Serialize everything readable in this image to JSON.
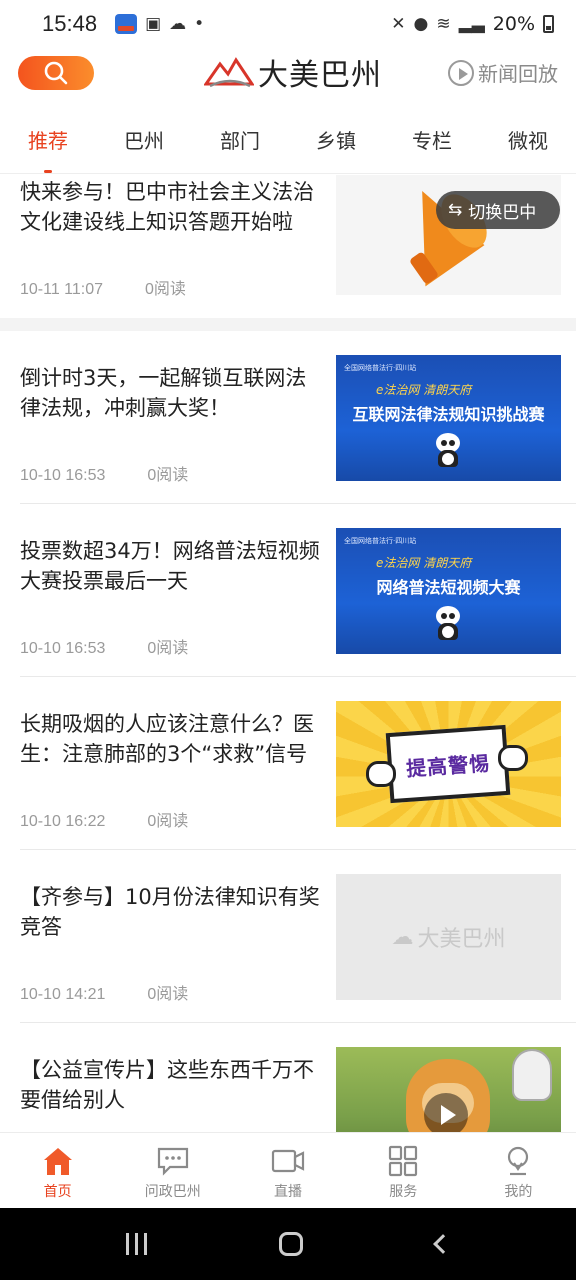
{
  "status_bar": {
    "time": "15:48",
    "battery": "20%",
    "icons": [
      "mute-icon",
      "location-icon",
      "wifi-icon",
      "signal-icon",
      "battery-icon"
    ]
  },
  "header": {
    "logo_text": "大美巴州",
    "replay_label": "新闻回放",
    "accent_color": "#e8421f"
  },
  "tabs": [
    {
      "label": "推荐",
      "active": true
    },
    {
      "label": "巴州",
      "active": false
    },
    {
      "label": "部门",
      "active": false
    },
    {
      "label": "乡镇",
      "active": false
    },
    {
      "label": "专栏",
      "active": false
    },
    {
      "label": "微视",
      "active": false
    }
  ],
  "switch_pill": {
    "label": "切换巴中"
  },
  "articles": [
    {
      "title": "快来参与！巴中市社会主义法治文化建设线上知识答题开始啦",
      "time": "10-11 11:07",
      "reads": "0阅读"
    },
    {
      "title": "倒计时3天，一起解锁互联网法律法规，冲刺赢大奖！",
      "time": "10-10 16:53",
      "reads": "0阅读",
      "thumb": {
        "top": "全国网络普法行·四川站",
        "brand": "e法治网 清朗天府",
        "title": "互联网法律法规知识挑战赛"
      }
    },
    {
      "title": "投票数超34万！网络普法短视频大赛投票最后一天",
      "time": "10-10 16:53",
      "reads": "0阅读",
      "thumb": {
        "top": "全国网络普法行·四川站",
        "brand": "e法治网 清朗天府",
        "title": "网络普法短视频大赛"
      }
    },
    {
      "title": "长期吸烟的人应该注意什么？医生：注意肺部的3个“求救”信号",
      "time": "10-10 16:22",
      "reads": "0阅读",
      "thumb": {
        "sign": "提高警惕"
      }
    },
    {
      "title": "【齐参与】10月份法律知识有奖竞答",
      "time": "10-10 14:21",
      "reads": "0阅读",
      "thumb": {
        "placeholder": "大美巴州"
      }
    },
    {
      "title": "【公益宣传片】这些东西千万不要借给别人",
      "time": "",
      "reads": ""
    }
  ],
  "bottom_nav": [
    {
      "label": "首页",
      "icon": "home-icon",
      "active": true
    },
    {
      "label": "问政巴州",
      "icon": "chat-icon",
      "active": false
    },
    {
      "label": "直播",
      "icon": "video-icon",
      "active": false
    },
    {
      "label": "服务",
      "icon": "grid-icon",
      "active": false
    },
    {
      "label": "我的",
      "icon": "user-icon",
      "active": false
    }
  ]
}
